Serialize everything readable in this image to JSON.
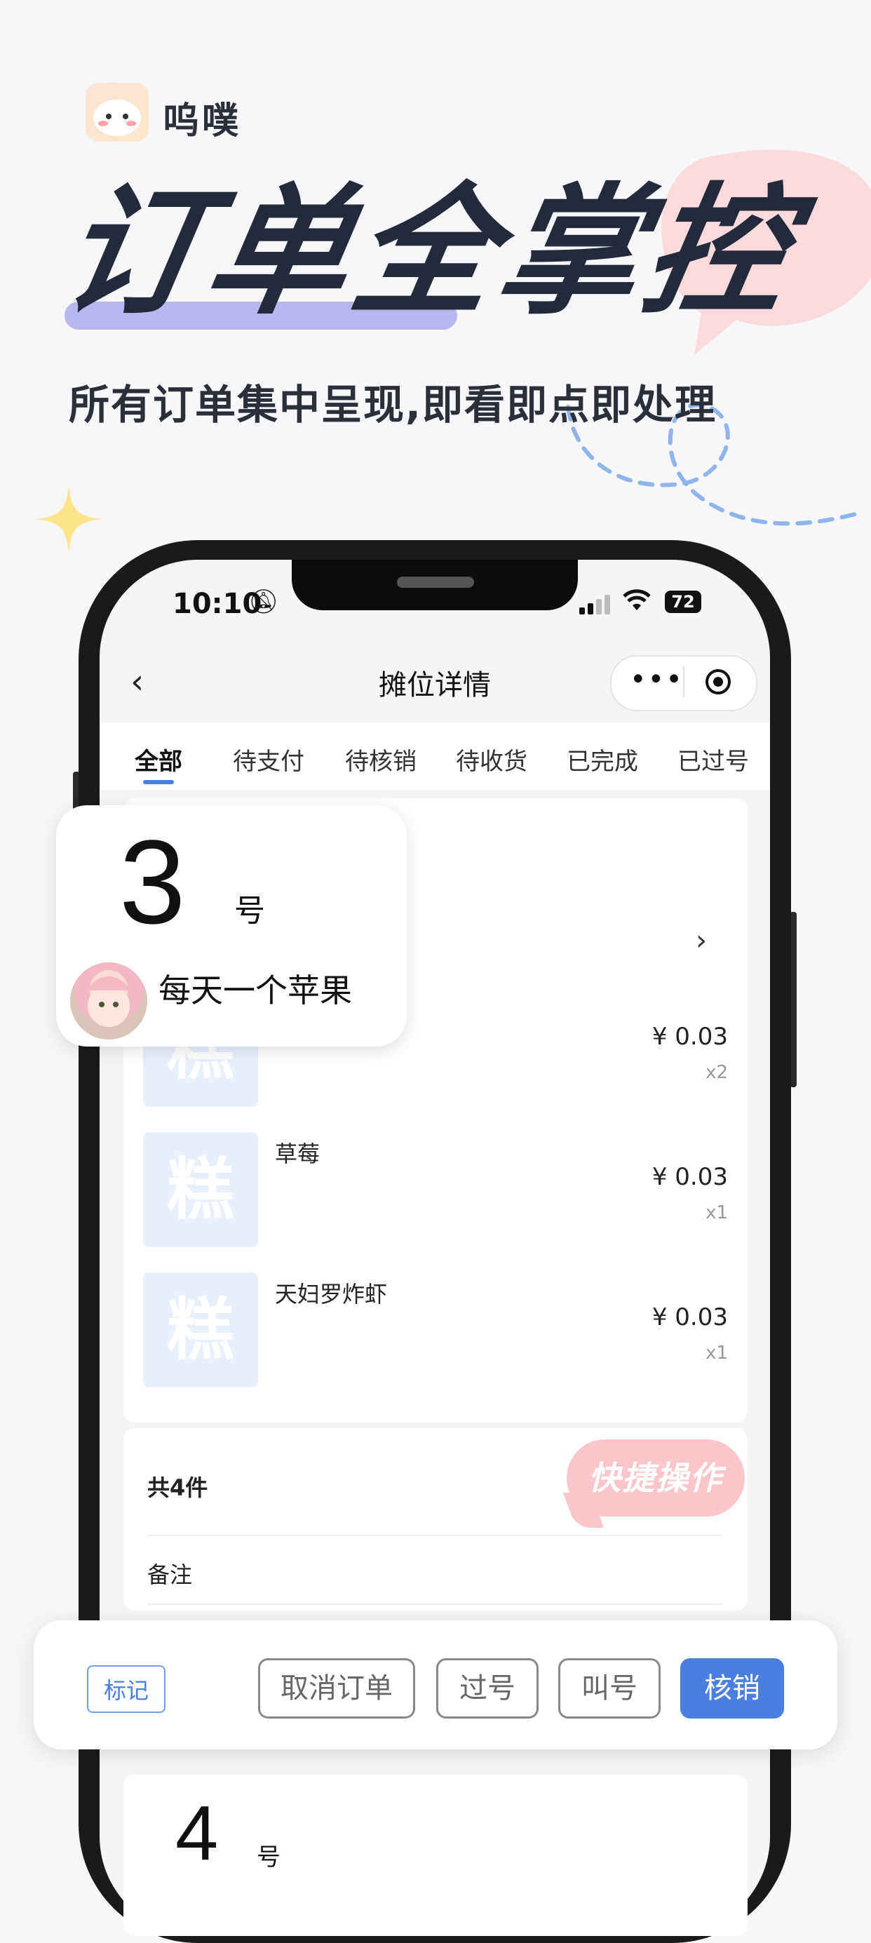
{
  "brand": {
    "name": "呜噗"
  },
  "headline": {
    "title": "订单全掌控",
    "subtitle": "所有订单集中呈现,即看即点即处理"
  },
  "status_bar": {
    "time": "10:10",
    "battery": "72"
  },
  "nav": {
    "back": "‹",
    "title": "摊位详情",
    "more": "•••"
  },
  "tabs": [
    {
      "label": "全部",
      "active": true
    },
    {
      "label": "待支付"
    },
    {
      "label": "待核销"
    },
    {
      "label": "待收货"
    },
    {
      "label": "已完成"
    },
    {
      "label": "已过号"
    }
  ],
  "order": {
    "items": [
      {
        "thumb": "糕",
        "name": "",
        "price": "¥ 0.03",
        "qty": "x2"
      },
      {
        "thumb": "糕",
        "name": "草莓",
        "price": "¥ 0.03",
        "qty": "x1"
      },
      {
        "thumb": "糕",
        "name": "天妇罗炸虾",
        "price": "¥ 0.03",
        "qty": "x1"
      }
    ],
    "total": "共4件",
    "remark": "备注"
  },
  "quick_badge": "快捷操作",
  "popup": {
    "number": "3",
    "unit": "号",
    "name": "每天一个苹果"
  },
  "actions": {
    "tag": "标记",
    "cancel": "取消订单",
    "skip": "过号",
    "call": "叫号",
    "verify": "核销"
  },
  "next_order": {
    "number": "4",
    "unit": "号"
  },
  "colors": {
    "accent": "#4a7fe0",
    "pink": "#fbc5cc",
    "title": "#232b3a",
    "underline": "#b8b6ef"
  }
}
